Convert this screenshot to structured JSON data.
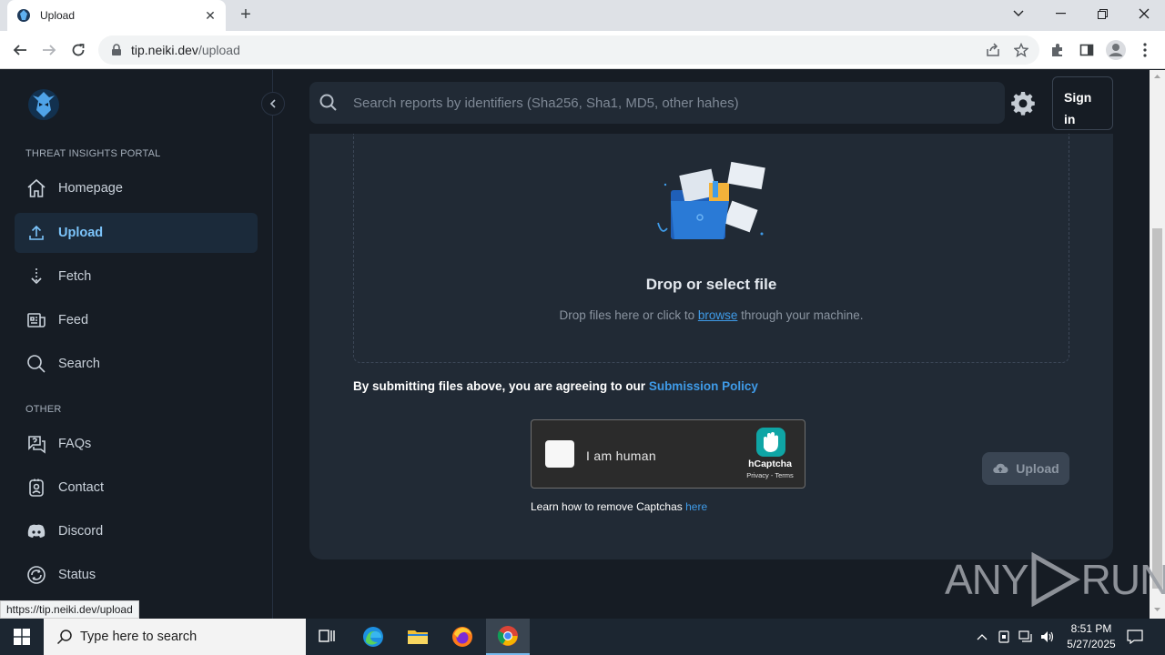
{
  "browser": {
    "tab_title": "Upload",
    "url_host": "tip.neiki.dev",
    "url_path": "/upload",
    "status_url": "https://tip.neiki.dev/upload"
  },
  "sidebar": {
    "section_main": "THREAT INSIGHTS PORTAL",
    "section_other": "OTHER",
    "items": [
      {
        "label": "Homepage",
        "icon": "home-icon"
      },
      {
        "label": "Upload",
        "icon": "upload-icon",
        "active": true
      },
      {
        "label": "Fetch",
        "icon": "fetch-icon"
      },
      {
        "label": "Feed",
        "icon": "feed-icon"
      },
      {
        "label": "Search",
        "icon": "search-icon"
      }
    ],
    "other_items": [
      {
        "label": "FAQs",
        "icon": "faq-icon"
      },
      {
        "label": "Contact",
        "icon": "contact-icon"
      },
      {
        "label": "Discord",
        "icon": "discord-icon"
      },
      {
        "label": "Status",
        "icon": "status-icon"
      }
    ]
  },
  "header": {
    "search_placeholder": "Search reports by identifiers (Sha256, Sha1, MD5, other hahes)",
    "signin_label": "Sign in"
  },
  "upload": {
    "title": "Drop or select file",
    "sub_before": "Drop files here or click to ",
    "sub_link": "browse",
    "sub_after": " through your machine.",
    "policy_text": "By submitting files above, you are agreeing to our ",
    "policy_link": "Submission Policy",
    "button_label": "Upload"
  },
  "captcha": {
    "label": "I am human",
    "brand": "hCaptcha",
    "terms": "Privacy - Terms",
    "learn_text": "Learn how to remove Captchas ",
    "learn_link": "here"
  },
  "watermark": {
    "left": "ANY",
    "right": "RUN"
  },
  "taskbar": {
    "search_placeholder": "Type here to search",
    "time": "8:51 PM",
    "date": "5/27/2025"
  },
  "colors": {
    "accent": "#3f9be8",
    "active_nav": "#7cc4fa",
    "card": "#212a35",
    "bg": "#161c24"
  }
}
